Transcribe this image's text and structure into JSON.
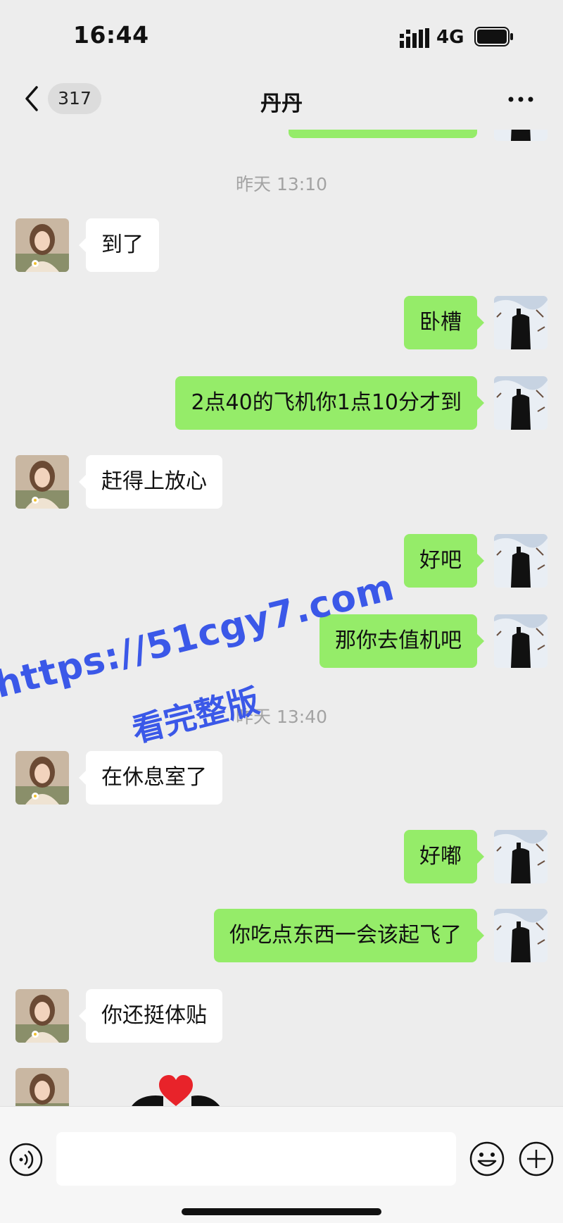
{
  "status_bar": {
    "time": "16:44",
    "network": "4G",
    "signal_icon": "signal-bars-icon",
    "battery_icon": "battery-icon"
  },
  "nav": {
    "back_icon": "chevron-left-icon",
    "unread_count": "317",
    "title": "丹丹",
    "more_icon": "more-dots-icon"
  },
  "messages": [
    {
      "type": "timestamp",
      "text": "昨天 13:10"
    },
    {
      "type": "incoming",
      "text": "到了"
    },
    {
      "type": "outgoing",
      "text": "卧槽"
    },
    {
      "type": "outgoing",
      "text": "2点40的飞机你1点10分才到"
    },
    {
      "type": "incoming",
      "text": "赶得上放心"
    },
    {
      "type": "outgoing",
      "text": "好吧"
    },
    {
      "type": "outgoing",
      "text": "那你去值机吧"
    },
    {
      "type": "timestamp",
      "text": "昨天 13:40"
    },
    {
      "type": "incoming",
      "text": "在休息室了"
    },
    {
      "type": "outgoing",
      "text": "好嘟"
    },
    {
      "type": "outgoing",
      "text": "你吃点东西一会该起飞了"
    },
    {
      "type": "incoming",
      "text": "你还挺体贴"
    },
    {
      "type": "incoming-sticker",
      "sticker": "heart-sticker"
    }
  ],
  "watermark": {
    "line1": "https://51cgy7.com",
    "line2": "看完整版"
  },
  "input_bar": {
    "voice_icon": "voice-icon",
    "input_value": "",
    "emoji_icon": "emoji-icon",
    "plus_icon": "plus-icon"
  },
  "colors": {
    "background": "#ededed",
    "outgoing_bubble": "#95ec69",
    "incoming_bubble": "#ffffff",
    "watermark": "#3b58e8",
    "heart": "#e8232a"
  }
}
